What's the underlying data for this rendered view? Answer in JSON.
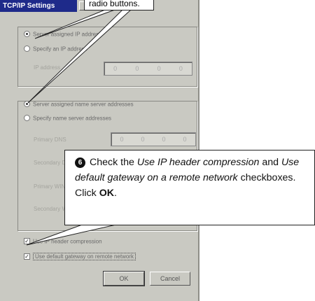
{
  "dialog": {
    "title": "TCP/IP Settings",
    "close_label": "",
    "radios": [
      {
        "label": "Server assigned IP address",
        "selected": true
      },
      {
        "label": "Specify an IP address",
        "selected": false
      }
    ],
    "ip_address_label": "IP address",
    "ip_octets": [
      "0",
      "0",
      "0",
      "0"
    ],
    "name_server_radios": [
      {
        "label": "Server assigned name server addresses",
        "selected": true
      },
      {
        "label": "Specify name server addresses",
        "selected": false
      }
    ],
    "dns_fields": [
      {
        "label": "Primary DNS",
        "octets": [
          "0",
          "0",
          "0",
          "0"
        ]
      },
      {
        "label": "Secondary DNS"
      },
      {
        "label": "Primary WINS"
      },
      {
        "label": "Secondary WINS"
      }
    ],
    "checkboxes": [
      {
        "label": "Use IP header compression",
        "checked": true
      },
      {
        "label": "Use default gateway on remote network",
        "checked": true
      }
    ],
    "ok_label": "OK",
    "cancel_label": "Cancel"
  },
  "callout_top": {
    "text": "radio buttons."
  },
  "callout": {
    "step_number": "6",
    "part1": "Check the ",
    "italic1": "Use IP header compression",
    "part2": " and ",
    "italic2": "Use default gateway on a remote network",
    "part3": " checkboxes. Click ",
    "bold": "OK",
    "part4": "."
  }
}
